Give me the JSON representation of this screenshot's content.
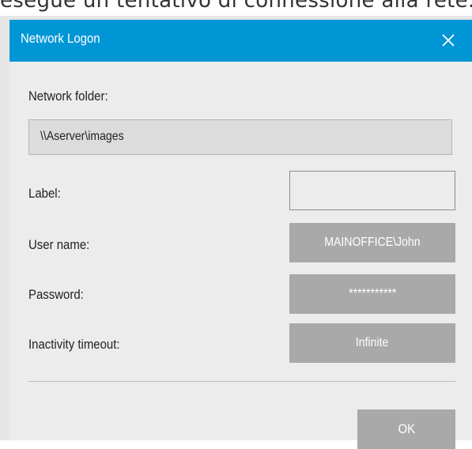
{
  "background": {
    "caption": "esegue un tentativo di connessione alla rete."
  },
  "dialog": {
    "title": "Network Logon",
    "close_icon": "close-icon",
    "accent_color": "#0096d6"
  },
  "form": {
    "network_folder_label": "Network folder:",
    "network_folder_value": "\\\\Aserver\\images",
    "label_label": "Label:",
    "label_value": "",
    "user_name_label": "User name:",
    "user_name_value": "MAINOFFICE\\John",
    "password_label": "Password:",
    "password_value": "***********",
    "inactivity_timeout_label": "Inactivity timeout:",
    "inactivity_timeout_value": "Infinite"
  },
  "buttons": {
    "ok_label": "OK"
  }
}
